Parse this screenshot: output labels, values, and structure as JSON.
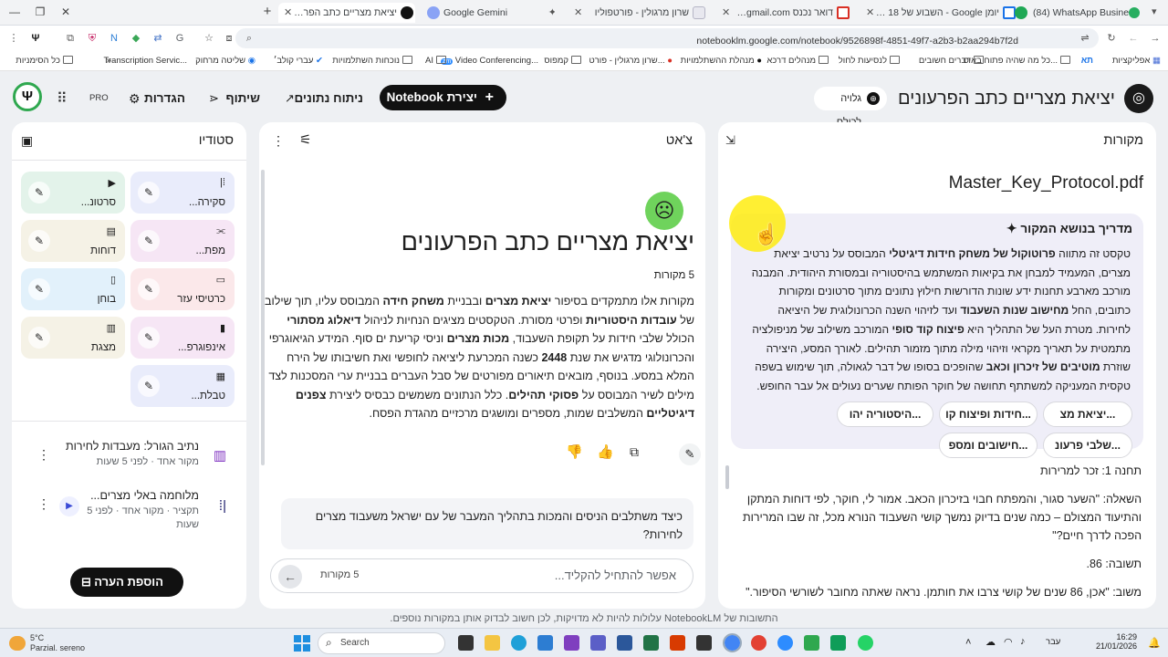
{
  "browser": {
    "tabs": [
      {
        "label": "יציאת מצריים כתב הפרעונים",
        "active": true
      },
      {
        "label": "Google Gemini"
      },
      {
        "label": "שרון מרגולין - פורטפוליו"
      },
      {
        "label": "דואר נכנס Gmail - ‎@gmail.com"
      },
      {
        "label": "יומן Google - השבוע של 18 בינו..."
      },
      {
        "label": "(84) WhatsApp Business"
      }
    ],
    "url": "notebooklm.google.com/notebook/9526898f-4851-49f7-a2b3-b2aa294b7f2d",
    "bookmarks": [
      "אפליקציות",
      "תא",
      "כל מה שהיה פתוח באיס...",
      "דברים חשובים",
      "לנסיעות לחול",
      "מנהלים דרכא",
      "מנהלת ההשתלמויות",
      "שרון מרגולין - פורט...",
      "קמפוס",
      "Video Conferencing...",
      "AI",
      "נוכחות השתלמויות",
      "עברי קולב׳",
      "שליטה מרחוק",
      "Transcription Servic...",
      "כל הסימניות"
    ]
  },
  "header": {
    "notebook_title": "יציאת מצריים כתב הפרעונים",
    "discover": "גלויה לכולם",
    "create_notebook": "יצירת Notebook",
    "analytics": "ניתוח נתונים",
    "share": "שיתוף",
    "settings": "הגדרות",
    "pro": "PRO"
  },
  "sources": {
    "panel_title": "מקורות",
    "file_name": "Master_Key_Protocol.pdf",
    "guide_title": "מדריך בנושא המקור",
    "guide_lines": [
      "טקסט זה מתווה <b>פרוטוקול של משחק חידות דיגיטלי</b> המבוסס על נרטיב יציאת",
      "מצרים, המעמיד למבחן את בקיאות המשתמש בהיסטוריה ובמסורת היהודית. המבנה",
      "מורכב מארבע תחנות ידע שונות הדורשות חילוץ נתונים מתוך סרטונים ומקורות",
      "כתובים, החל <b>מחישוב שנות השעבוד</b> ועד לזיהוי השנה הכרונולוגית של היציאה",
      "לחירות. מטרת העל של התהליך היא <b>פיצוח קוד סופי</b> המורכב משילוב של מניפולציה",
      "מתמטית על תאריך מקראי וזיהוי מילה מתוך מזמור תהילים. לאורך המסע, היצירה",
      "שוזרת <b>מוטיבים של זיכרון וכאב</b> שהופכים בסופו של דבר לגאולה, תוך שימוש בשפה",
      "טקסית המעניקה למשתתף תחושה של חוקר הפותח שערים נעולים אל עבר החופש."
    ],
    "chips_row1": [
      "יציאת מצ...",
      "חידות ופיצוח קו...",
      "היסטוריה יהו..."
    ],
    "chips_row2": [
      "שלבי פרעונ...",
      "חישובים ומספ..."
    ],
    "station_title": "תחנה 1: זכר למרירות",
    "q1": "השאלה: \"השער סגור, והמפתח חבוי בזיכרון הכאב. אמור לי, חוקר, לפי דוחות המתקן",
    "q2": "והתיעוד המצולם – כמה שנים בדיוק נמשך קושי השעבוד הנורא מכל, זה שבו המרירות",
    "q3": "הפכה לדרך חיים?\"",
    "answer": "תשובה: 86.",
    "response": "משוב: \"אכן, 86 שנים של קושי צרבו את חותמן. נראה שאתה מחובר לשורשי הסיפור.\""
  },
  "chat": {
    "panel_title": "צ'אט",
    "title": "יציאת מצריים כתב הפרעונים",
    "source_count": "5 מקורות",
    "summary_lines": [
      "מקורות אלו מתמקדים בסיפור <b>יציאת מצרים</b> ובבניית <b>משחק חידה</b> המבוסס עליו, תוך שילוב",
      "של <b>עובדות היסטוריות</b> ופרטי מסורת. הטקסטים מציגים הנחיות לניהול <b>דיאלוג מסתורי</b>",
      "הכולל שלבי חידות על תקופת השעבוד, <b>מכות מצרים</b> וניסי קריעת ים סוף. המידע הגיאוגרפי",
      "והכרונולוגי מדגיש את שנת <b>2448</b> כשנה המכרעת ליציאה לחופשי ואת חשיבותו של הירח",
      "המלא במסע. בנוסף, מובאים תיאורים מפורטים של סבל העברים בבניית ערי המסכנות לצד",
      "מילים לשיר המבוסס על <b>פסוקי תהילים</b>. כלל הנתונים משמשים כבסיס ליצירת <b>צפנים</b>",
      "<b>דיגיטליים</b> המשלבים שמות, מספרים ומושגים מרכזיים מהגדת הפסח."
    ],
    "suggestion_1": "כיצד משתלבים הניסים והמכות בתהליך המעבר של עם ישראל משעבוד מצרים",
    "suggestion_2": "לחירות?",
    "input_placeholder": "אפשר להתחיל להקליד...",
    "input_sources": "5 מקורות"
  },
  "studio": {
    "panel_title": "סטודיו",
    "cards": [
      {
        "label": "סקירה...",
        "color": "#e9ecfb"
      },
      {
        "label": "סרטונ...",
        "color": "#e3f3ea"
      },
      {
        "label": "מפת...",
        "color": "#f6e6f5"
      },
      {
        "label": "דוחות",
        "color": "#f5f2e6"
      },
      {
        "label": "כרטיסי עזר",
        "color": "#fbe8ea"
      },
      {
        "label": "בוחן",
        "color": "#e2f1fb"
      },
      {
        "label": "אינפוגרפ...",
        "color": "#f6e6f5"
      },
      {
        "label": "מצגת",
        "color": "#f5f2e6"
      },
      {
        "label": "טבלת...",
        "color": "#e9ecfb"
      }
    ],
    "notes": [
      {
        "title": "נתיב הגורל: מעבדות לחירות",
        "meta": "מקור אחד · לפני 5 שעות"
      },
      {
        "title": "מלוחמה באלי מצרים...",
        "meta1": "תקציר · מקור אחד · לפני 5",
        "meta2": "שעות"
      }
    ],
    "add_note": "הוספת הערה"
  },
  "footer_disclaimer": "התשובות של NotebookLM עלולות להיות לא מדויקות, לכן חשוב לבדוק אותן במקורות נוספים.",
  "taskbar": {
    "weather_temp": "5°C",
    "weather_desc": "Parzial. sereno",
    "search": "Search",
    "lang": "עבר",
    "time": "16:29",
    "date": "21/01/2026"
  }
}
